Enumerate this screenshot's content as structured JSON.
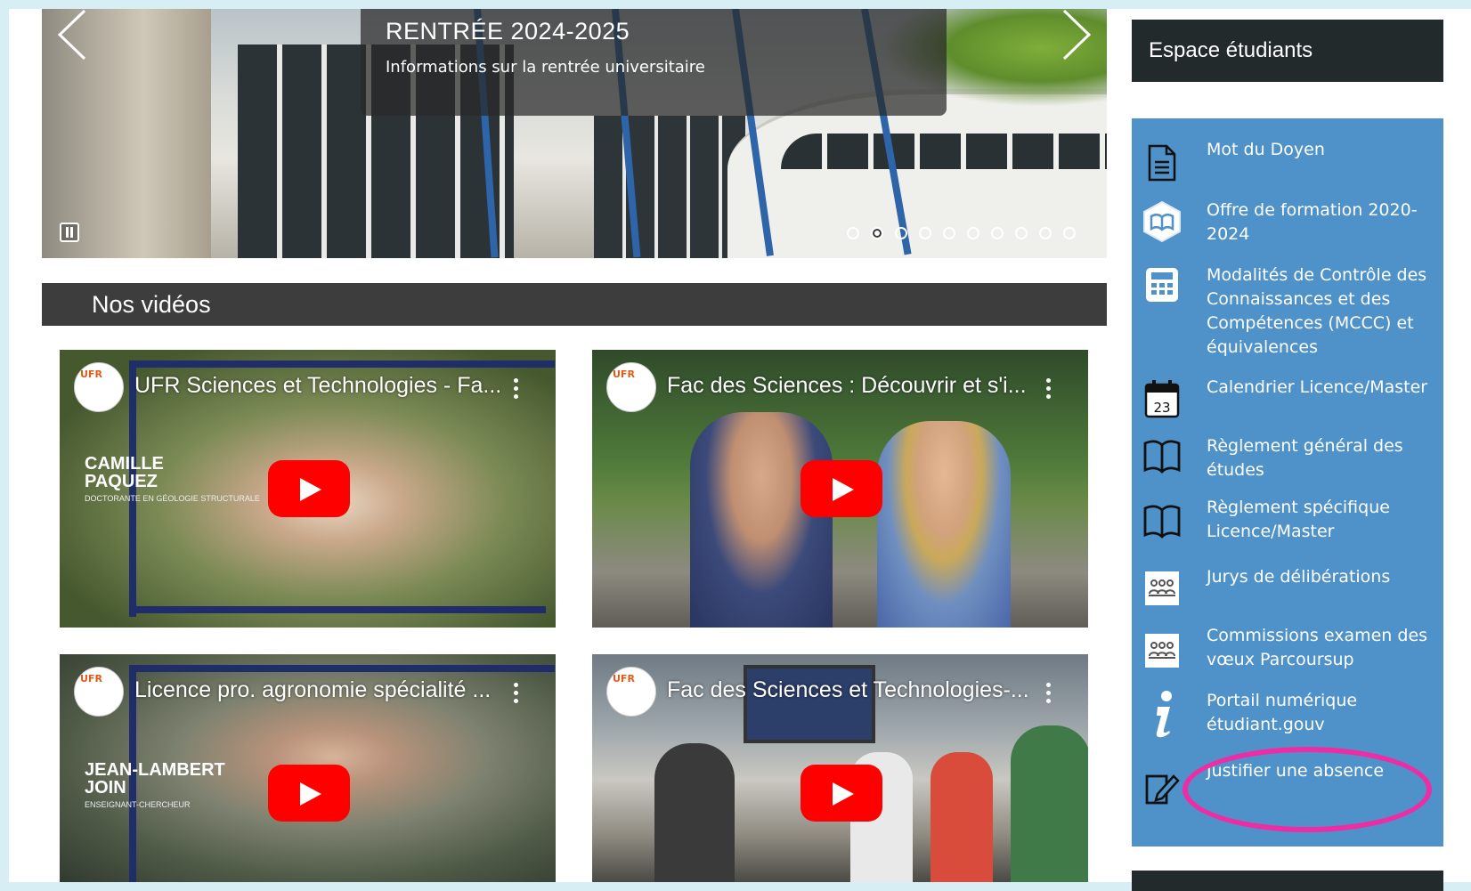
{
  "slider": {
    "title": "RENTRÉE 2024-2025",
    "subtitle": "Informations sur la rentrée universitaire",
    "slide_count": 10,
    "active_slide": 2
  },
  "videos": {
    "heading": "Nos vidéos",
    "items": [
      {
        "title": "UFR Sciences et Technologies - Fa...",
        "name_tag": [
          "CAMILLE",
          "PAQUEZ"
        ],
        "name_sub": "DOCTORANTE EN GÉOLOGIE STRUCTURALE"
      },
      {
        "title": "Fac des Sciences : Découvrir et s'i...",
        "name_tag": [],
        "name_sub": ""
      },
      {
        "title": "Licence pro. agronomie spécialité ...",
        "name_tag": [
          "JEAN-LAMBERT",
          "JOIN"
        ],
        "name_sub": "ENSEIGNANT-CHERCHEUR"
      },
      {
        "title": "Fac des Sciences et Technologies-...",
        "name_tag": [],
        "name_sub": ""
      }
    ]
  },
  "sidebar": {
    "heading": "Espace étudiants",
    "items": [
      {
        "label": "Mot du Doyen",
        "icon": "document-icon"
      },
      {
        "label": "Offre de formation 2020-2024",
        "icon": "book-hexagon-icon"
      },
      {
        "label": "Modalités de Contrôle des Connaissances et des Compétences (MCCC) et équivalences",
        "icon": "calculator-icon"
      },
      {
        "label": "Calendrier Licence/Master",
        "icon": "calendar-icon",
        "calendar_day": "23"
      },
      {
        "label": "Règlement général des études",
        "icon": "open-book-icon"
      },
      {
        "label": "Règlement spécifique Licence/Master",
        "icon": "open-book-icon"
      },
      {
        "label": "Jurys de délibérations",
        "icon": "jury-icon"
      },
      {
        "label": "Commissions examen des vœux Parcoursup",
        "icon": "jury-icon"
      },
      {
        "label": "Portail numérique étudiant.gouv",
        "icon": "info-icon"
      },
      {
        "label": "Justifier une absence",
        "icon": "edit-form-icon"
      }
    ],
    "highlight_color": "#ee2da5",
    "box_color": "#4f92c9"
  }
}
